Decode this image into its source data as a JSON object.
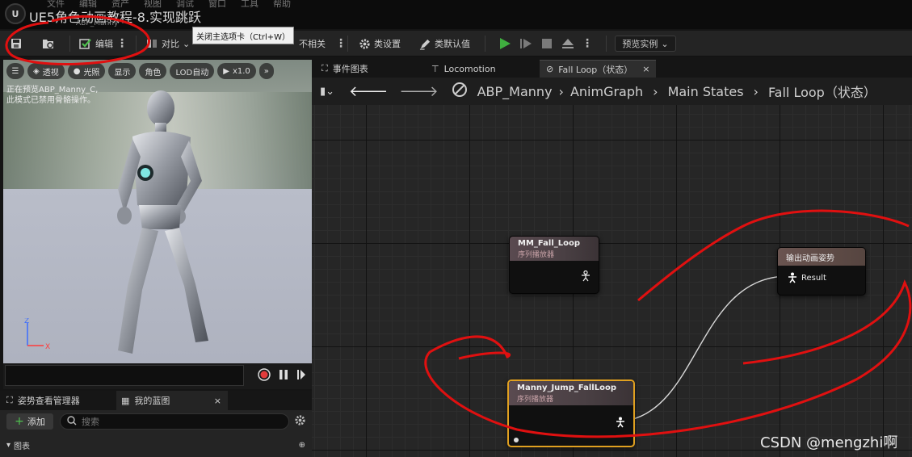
{
  "window": {
    "logo": "U",
    "menu_items": [
      "文件",
      "编辑",
      "资产",
      "视图",
      "调试",
      "窗口",
      "工具",
      "帮助"
    ],
    "title": "UE5角色动画教程-8.实现跳跃",
    "subtitle": "ABP_Manny"
  },
  "toolbar": {
    "save_icon": "save-icon",
    "browse_icon": "browse-icon",
    "compile_label": "编辑",
    "diff_label": "对比",
    "hidden_label": "不相关",
    "class_settings_label": "类设置",
    "class_defaults_label": "类默认值",
    "preview_label": "预览实例",
    "tooltip": "关闭主选项卡（Ctrl+W）",
    "colors": {
      "play": "#3fae3f",
      "toolbar_bg": "#242424"
    }
  },
  "viewport": {
    "buttons": [
      "透视",
      "光照",
      "显示",
      "角色",
      "LOD自动",
      "x1.0"
    ],
    "menu_icon": "hamburger-icon",
    "info_line1": "正在预览ABP_Manny_C,",
    "info_line2": "此模式已禁用骨骼操作。",
    "axis_x": "X",
    "axis_z": "Z"
  },
  "bottom_left": {
    "tabs": [
      "姿势查看管理器",
      "我的蓝图"
    ],
    "add_label": "添加",
    "search_placeholder": "搜索",
    "section_label": "图表"
  },
  "graph_editor": {
    "tabs": [
      "事件图表",
      "Locomotion",
      "Fall Loop（状态）"
    ],
    "breadcrumb": [
      "ABP_Manny",
      "AnimGraph",
      "Main States",
      "Fall Loop（状态）"
    ],
    "nodes": [
      {
        "title": "MM_Fall_Loop",
        "subtitle": "序列播放器"
      },
      {
        "title": "Manny_Jump_FallLoop",
        "subtitle": "序列播放器"
      }
    ],
    "output_node": {
      "title": "输出动画姿势",
      "pin_label": "Result"
    }
  },
  "watermark": "CSDN @mengzhi啊"
}
